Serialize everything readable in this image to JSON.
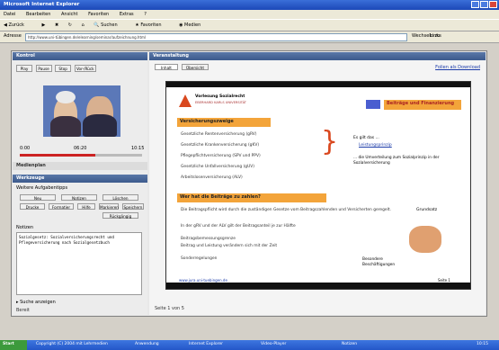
{
  "window": {
    "title": "Microsoft Internet Explorer"
  },
  "menu": [
    "Datei",
    "Bearbeiten",
    "Ansicht",
    "Favoriten",
    "Extras",
    "?"
  ],
  "toolbar": {
    "back": "Zurück",
    "search": "Suchen",
    "favorites": "Favoriten",
    "media": "Medien"
  },
  "address": {
    "label": "Adresse",
    "url": "http://www.uni-tübingen.de/elearning/seminar/aufzeichnung.html",
    "go": "Wechseln zu",
    "links": "Links"
  },
  "left_panel": {
    "header": "Kontrol",
    "tabs": [
      "Play",
      "Pause",
      "Stop",
      "Vor-/Rück"
    ],
    "time_start": "0:00",
    "time_mid": "06:20",
    "time_end": "10:15",
    "section2": "Medienplan",
    "tools_header": "Werkzeuge",
    "tools_sub": "Weitere Aufgabentipps",
    "tool_buttons": [
      "Neu",
      "Notizen",
      "Löschen",
      "Drucke",
      "Formatier",
      "Hilfe",
      "Markieren",
      "Speichern",
      "Rückgängig"
    ],
    "notes_label": "Notizen",
    "notes_text": "Sozialgesetz: Sozialversicherungsrecht und Pflegeversicherung nach Sozialgesetzbuch",
    "search_btn": "Suche anzeigen",
    "status": "Bereit"
  },
  "right_panel": {
    "header": "Veranstaltung",
    "tabs": [
      "Inhalt",
      "Übersicht"
    ],
    "link": "Folien als Download",
    "footer": "Seite 1 von 5"
  },
  "slide": {
    "logo_line1": "Vorlesung Sozialrecht",
    "logo_line2": "EBERHARD KARLS UNIVERSITÄT",
    "title_box": "Beiträge und Finanzierung",
    "section1": "Versicherungszweige",
    "bullets1": [
      "Gesetzliche Rentenversicherung (gRV)",
      "Gesetzliche Krankenversicherung (gKV)",
      "Pflegepflichtversicherung (SPV und PPV)",
      "Gesetzliche Unfallversicherung (gUV)",
      "Arbeitslosenversicherung (ALV)"
    ],
    "right_note1": "Es gilt das ...",
    "right_note1b": "Leistungsprinzip",
    "right_note2": "... die Umverteilung zum Sozialprinzip in der Sozialversicherung",
    "section2": "Wer hat die Beiträge zu zahlen?",
    "bullets2": [
      "Die Beitragspflicht wird durch die zuständigen Gesetze vom Beitragszahlenden und Versicherten geregelt.",
      "In der gRV und der ALV gilt der Beitragsanteil je zur Hälfte",
      "Beitragsbemessungsgrenze",
      "Beitrag und Leistung verändern sich mit der Zeit",
      "Sonderregelungen"
    ],
    "grundsatz_label": "Grundsatz",
    "special": "Besondere Beschäftigungen",
    "footer_url": "www.jura.uni-tuebingen.de",
    "page_num": "Seite 1"
  },
  "taskbar": {
    "start": "Start",
    "copyright": "Copyright (C) 2004 mit Lehrmedien",
    "items": [
      "Anwendung",
      "Internet Explorer",
      "Video-Player",
      "Notizen"
    ],
    "clock": "10:15"
  }
}
